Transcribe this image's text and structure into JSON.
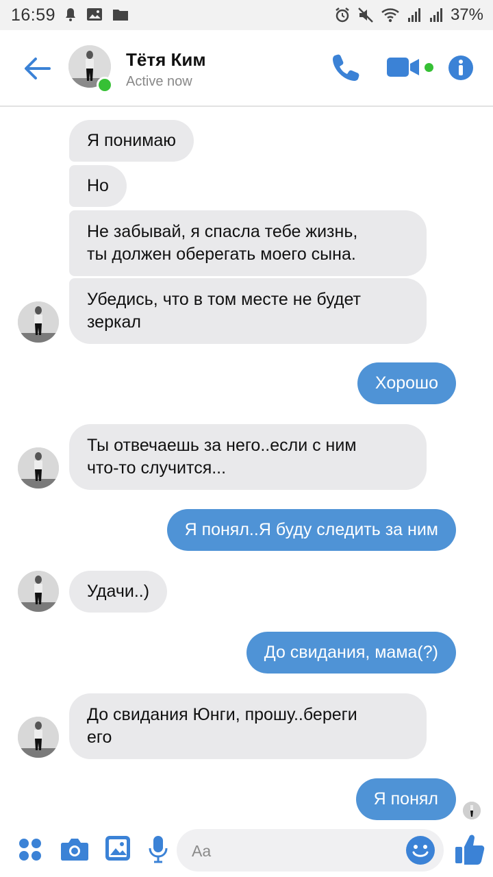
{
  "status_bar": {
    "time": "16:59",
    "battery": "37%",
    "left_icons": [
      "notification-bell-icon",
      "gallery-icon",
      "folder-icon"
    ],
    "right_icons": [
      "alarm-icon",
      "mute-icon",
      "wifi-icon",
      "signal-icon",
      "signal-icon"
    ]
  },
  "header": {
    "contact_name": "Тётя Ким",
    "status": "Active now",
    "icons": [
      "back-arrow-icon",
      "phone-icon",
      "video-camera-icon",
      "info-icon"
    ]
  },
  "messages": [
    {
      "from": "them",
      "text": "Я понимаю"
    },
    {
      "from": "them",
      "text": "Но"
    },
    {
      "from": "them",
      "line1": "Не забывай, я спасла тебе жизнь,",
      "line2": "ты должен оберегать моего сына."
    },
    {
      "from": "them",
      "line1": "Убедись, что в том месте не будет",
      "line2": "зеркал"
    },
    {
      "from": "me",
      "text": "Хорошо"
    },
    {
      "from": "them",
      "line1": "Ты отвечаешь за него..если с ним",
      "line2": "что-то случится..."
    },
    {
      "from": "me",
      "text": "Я понял..Я буду следить за ним"
    },
    {
      "from": "them",
      "text": "Удачи..)"
    },
    {
      "from": "me",
      "text": "До свидания, мама(?)"
    },
    {
      "from": "them",
      "line1": "До свидания Юнги, прошу..береги",
      "line2": "его"
    },
    {
      "from": "me",
      "text": "Я понял"
    }
  ],
  "composer": {
    "placeholder": "Aa",
    "icons": [
      "apps-icon",
      "camera-icon",
      "image-icon",
      "microphone-icon",
      "emoji-icon",
      "thumbs-up-icon"
    ]
  },
  "colors": {
    "accent": "#4f93d6",
    "incoming_bubble": "#e9e9eb",
    "online": "#36c035"
  }
}
